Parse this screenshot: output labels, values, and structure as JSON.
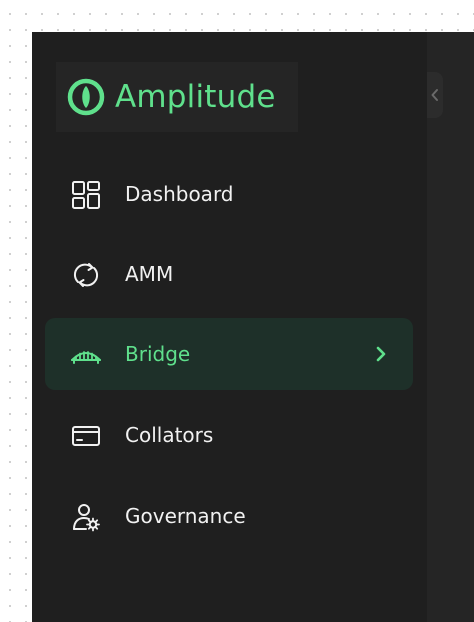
{
  "app": {
    "logo_text": "Amplitude",
    "brand_color": "#5fe08c",
    "logo_icon": "amplitude-logo-icon"
  },
  "sidebar": {
    "collapse_icon": "chevron-left-icon",
    "items": [
      {
        "label": "Dashboard",
        "icon": "dashboard-icon",
        "active": false
      },
      {
        "label": "AMM",
        "icon": "swap-refresh-icon",
        "active": false
      },
      {
        "label": "Bridge",
        "icon": "bridge-icon",
        "active": true
      },
      {
        "label": "Collators",
        "icon": "card-icon",
        "active": false
      },
      {
        "label": "Governance",
        "icon": "user-gear-icon",
        "active": false
      }
    ],
    "active_background": "#1e3029",
    "background": "#1f1f1f"
  }
}
